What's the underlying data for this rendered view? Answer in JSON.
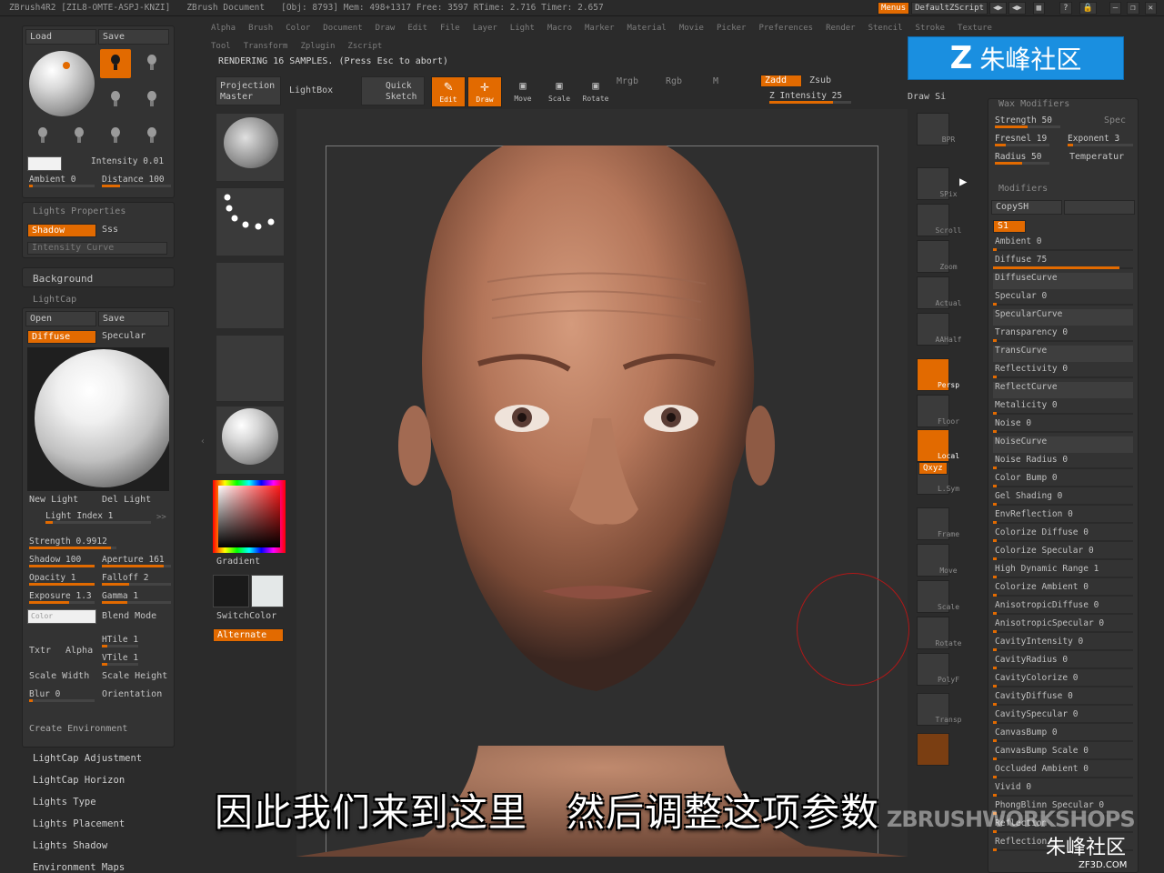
{
  "titlebar": {
    "app": "ZBrush4R2 [ZIL8-OMTE-ASPJ-KNZI]",
    "document": "ZBrush Document",
    "obj": "[Obj: 8793] Mem: 498+1317 Free: 3597 RTime: 2.716 Timer: 2.657",
    "menus": "Menus",
    "zscript": "DefaultZScript"
  },
  "menubar": {
    "row1": [
      "Alpha",
      "Brush",
      "Color",
      "Document",
      "Draw",
      "Edit",
      "File",
      "Layer",
      "Light",
      "Macro",
      "Marker",
      "Material",
      "Movie",
      "Picker",
      "Preferences",
      "Render",
      "Stencil",
      "Stroke",
      "Texture"
    ],
    "row2": [
      "Tool",
      "Transform",
      "Zplugin",
      "Zscript"
    ]
  },
  "rendering": "RENDERING 16 SAMPLES. (Press Esc to abort)",
  "toolbar": {
    "projection_master": "Projection Master",
    "lightbox": "LightBox",
    "quick_sketch": "Quick Sketch",
    "edit": "Edit",
    "draw": "Draw",
    "move": "Move",
    "scale": "Scale",
    "rotate": "Rotate",
    "mrgb": "Mrgb",
    "rgb": "Rgb",
    "m": "M",
    "zadd": "Zadd",
    "zsub": "Zsub",
    "z_intensity": "Z Intensity 25",
    "draw_size": "Draw Si"
  },
  "left": {
    "load": "Load",
    "save": "Save",
    "intensity": "Intensity 0.01",
    "ambient": "Ambient 0",
    "distance": "Distance 100",
    "lights_properties": "Lights Properties",
    "shadow": "Shadow",
    "sss": "Sss",
    "intensity_curve": "Intensity Curve",
    "background": "Background",
    "lightcap": "LightCap",
    "open": "Open",
    "save2": "Save",
    "diffuse": "Diffuse",
    "specular": "Specular",
    "new_light": "New Light",
    "del_light": "Del Light",
    "light_index": "Light Index 1",
    "strength": "Strength 0.9912",
    "shadow100": "Shadow 100",
    "aperture": "Aperture 161",
    "opacity": "Opacity 1",
    "falloff": "Falloff 2",
    "exposure": "Exposure 1.3",
    "gamma": "Gamma 1",
    "color": "Color",
    "blend_mode": "Blend Mode",
    "htile": "HTile 1",
    "vtile": "VTile 1",
    "txtr": "Txtr",
    "alpha": "Alpha",
    "scale_width": "Scale Width",
    "scale_height": "Scale Height",
    "blur": "Blur 0",
    "orientation": "Orientation",
    "create_env": "Create Environment",
    "sections": [
      "LightCap Adjustment",
      "LightCap Horizon",
      "Lights Type",
      "Lights Placement",
      "Lights Shadow",
      "Environment Maps"
    ]
  },
  "swatch": {
    "gradient": "Gradient",
    "switch_color": "SwitchColor",
    "alternate": "Alternate"
  },
  "righttools": [
    "BPR",
    "SPix",
    "Scroll",
    "Zoom",
    "Actual",
    "AAHalf",
    "Persp",
    "Floor",
    "Local",
    "L.Sym",
    "Qxyz",
    "Frame",
    "Move",
    "Scale",
    "Rotate",
    "PolyF",
    "Transp"
  ],
  "right": {
    "wax_modifiers": "Wax Modifiers",
    "strength": "Strength 50",
    "spec": "Spec",
    "fresnel": "Fresnel 19",
    "exponent": "Exponent 3",
    "radius": "Radius 50",
    "temperature": "Temperatur",
    "modifiers": "Modifiers",
    "copysh": "CopySH",
    "s1": "S1",
    "rows": [
      {
        "label": "Ambient 0",
        "fill": 0.0
      },
      {
        "label": "Diffuse 75",
        "fill": 0.9
      },
      {
        "label": "DiffuseCurve",
        "fill": 0
      },
      {
        "label": "Specular 0",
        "fill": 0.0
      },
      {
        "label": "SpecularCurve",
        "fill": 0
      },
      {
        "label": "Transparency 0",
        "fill": 0.0
      },
      {
        "label": "TransCurve",
        "fill": 0
      },
      {
        "label": "Reflectivity 0",
        "fill": 0.0
      },
      {
        "label": "ReflectCurve",
        "fill": 0
      },
      {
        "label": "Metalicity 0",
        "fill": 0.0
      },
      {
        "label": "Noise 0",
        "fill": 0.0
      },
      {
        "label": "NoiseCurve",
        "fill": 0
      },
      {
        "label": "Noise Radius 0",
        "fill": 0.0
      },
      {
        "label": "Color Bump 0",
        "fill": 0.0
      },
      {
        "label": "Gel Shading 0",
        "fill": 0.0
      },
      {
        "label": "EnvReflection 0",
        "fill": 0.0
      },
      {
        "label": "Colorize Diffuse 0",
        "fill": 0.0
      },
      {
        "label": "Colorize Specular 0",
        "fill": 0.0
      },
      {
        "label": "High Dynamic Range 1",
        "fill": 0.0
      },
      {
        "label": "Colorize Ambient 0",
        "fill": 0.0
      },
      {
        "label": "AnisotropicDiffuse 0",
        "fill": 0.0
      },
      {
        "label": "AnisotropicSpecular 0",
        "fill": 0.0
      },
      {
        "label": "CavityIntensity 0",
        "fill": 0.0
      },
      {
        "label": "CavityRadius 0",
        "fill": 0.0
      },
      {
        "label": "CavityColorize 0",
        "fill": 0.0
      },
      {
        "label": "CavityDiffuse 0",
        "fill": 0.0
      },
      {
        "label": "CavitySpecular 0",
        "fill": 0.0
      },
      {
        "label": "CanvasBump 0",
        "fill": 0.0
      },
      {
        "label": "CanvasBump Scale 0",
        "fill": 0.0
      },
      {
        "label": "Occluded Ambient 0",
        "fill": 0.0
      },
      {
        "label": "Vivid 0",
        "fill": 0.0
      },
      {
        "label": "PhongBlinn Specular 0",
        "fill": 0.0
      },
      {
        "label": "Reflection",
        "fill": 0.0
      },
      {
        "label": "Reflection",
        "fill": 0.0
      }
    ]
  },
  "subtitle": "因此我们来到这里　然后调整这项参数",
  "watermark": {
    "top": "朱峰社区",
    "workshops": "ZBRUSHWORKSHOPS",
    "bottom_cn": "朱峰社区",
    "bottom_url": "ZF3D.COM"
  },
  "colors": {
    "accent": "#e26a00",
    "panel": "#333333",
    "background": "#2b2b2b",
    "watermark_blue": "#1a8fe0"
  }
}
